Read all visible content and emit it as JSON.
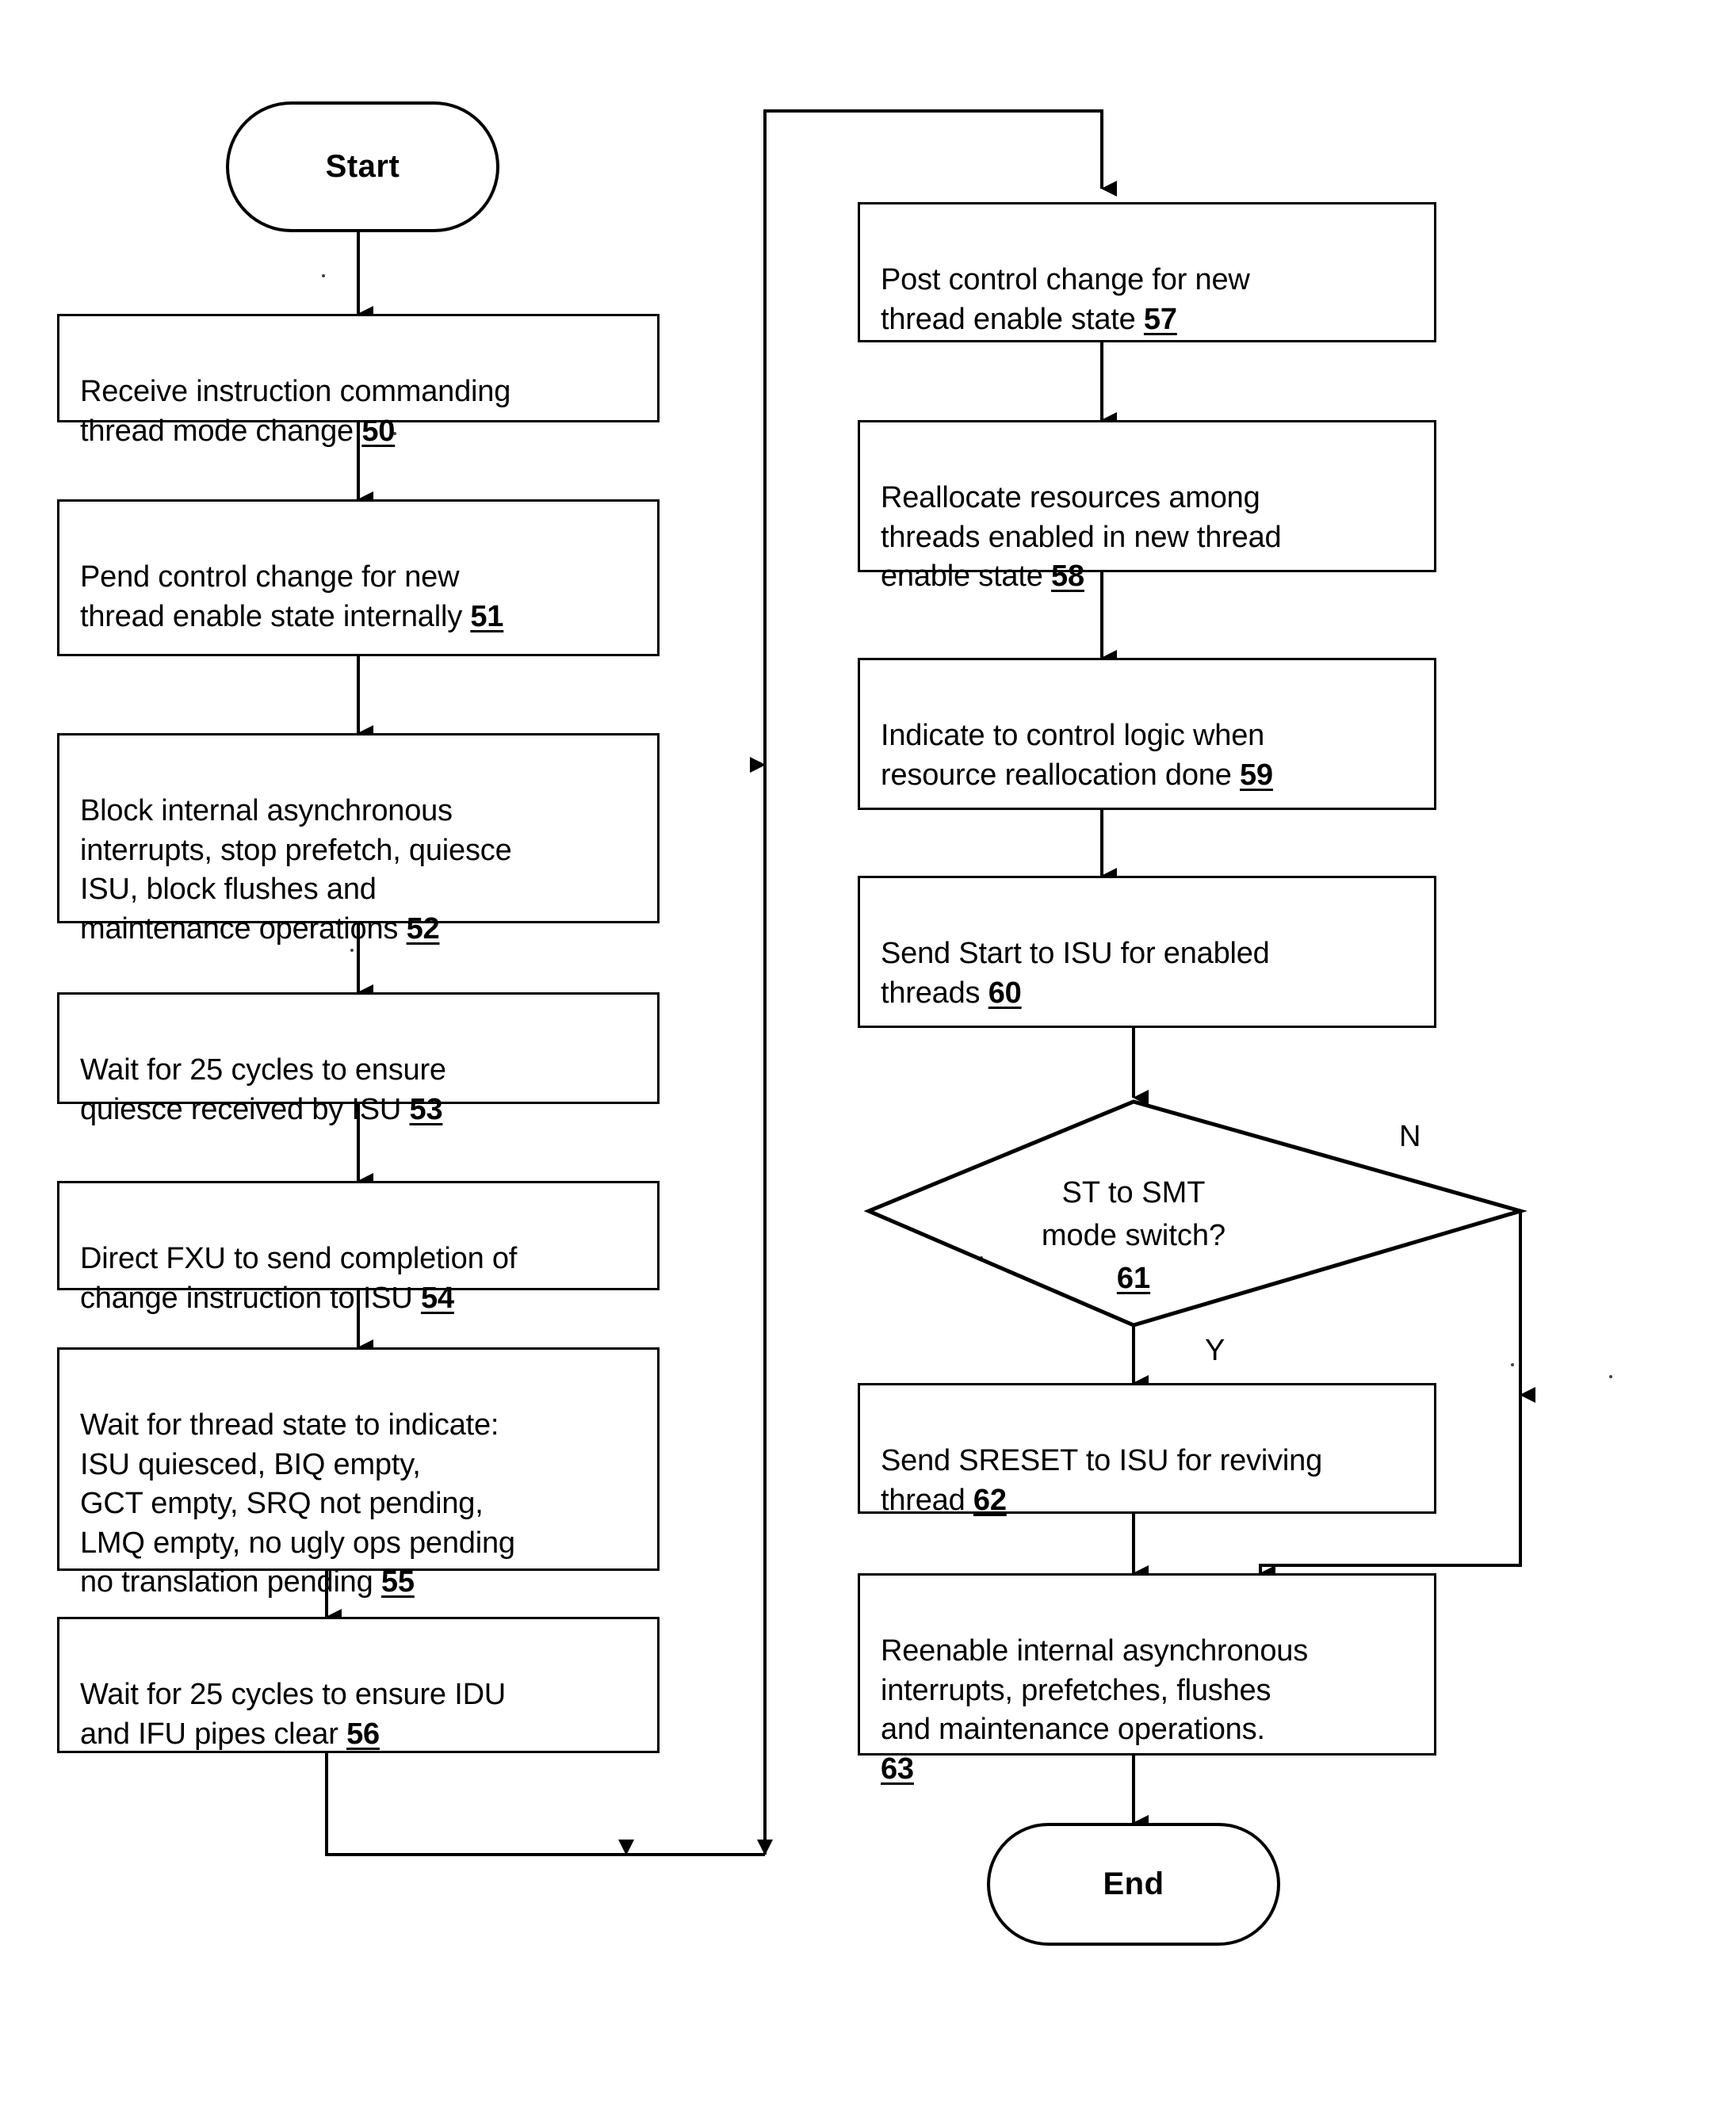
{
  "figure": {
    "type": "flowchart",
    "title": "Thread mode change flowchart",
    "orientation": "two-column"
  },
  "colors": {
    "stroke": "#000000",
    "background": "#ffffff",
    "text": "#000000"
  },
  "terminals": {
    "start": "Start",
    "end": "End"
  },
  "branch_labels": {
    "yes": "Y",
    "no": "N"
  },
  "nodes": {
    "n50": {
      "text": "Receive instruction commanding\nthread mode change ",
      "ref": "50"
    },
    "n51": {
      "text": "Pend control change for new\nthread enable state internally ",
      "ref": "51"
    },
    "n52": {
      "text": "Block internal asynchronous\ninterrupts, stop prefetch, quiesce\nISU, block flushes and\nmaintenance operations ",
      "ref": "52"
    },
    "n53": {
      "text": "Wait for 25 cycles to ensure\nquiesce received by ISU ",
      "ref": "53"
    },
    "n54": {
      "text": "Direct FXU to send completion of\nchange instruction to ISU ",
      "ref": "54"
    },
    "n55": {
      "text": "Wait for thread state to indicate:\nISU quiesced, BIQ empty,\nGCT empty, SRQ not pending,\nLMQ empty, no ugly ops pending\nno translation pending    ",
      "ref": "55"
    },
    "n56": {
      "text": "Wait for 25 cycles to ensure IDU\nand IFU pipes clear ",
      "ref": "56"
    },
    "n57": {
      "text": "Post control change for new\nthread enable state  ",
      "ref": "57"
    },
    "n58": {
      "text": "Reallocate resources among\nthreads enabled in new thread\nenable state   ",
      "ref": "58"
    },
    "n59": {
      "text": "Indicate to control logic when\nresource reallocation done   ",
      "ref": "59"
    },
    "n60": {
      "text": "Send Start to ISU for enabled\nthreads   ",
      "ref": "60"
    },
    "n61": {
      "text": "ST to SMT\nmode switch?\n",
      "ref": "61"
    },
    "n62": {
      "text": "Send SRESET to ISU for reviving\nthread   ",
      "ref": "62"
    },
    "n63": {
      "text": "Reenable internal asynchronous\ninterrupts, prefetches, flushes\nand  maintenance operations.\n",
      "ref": "63"
    }
  }
}
